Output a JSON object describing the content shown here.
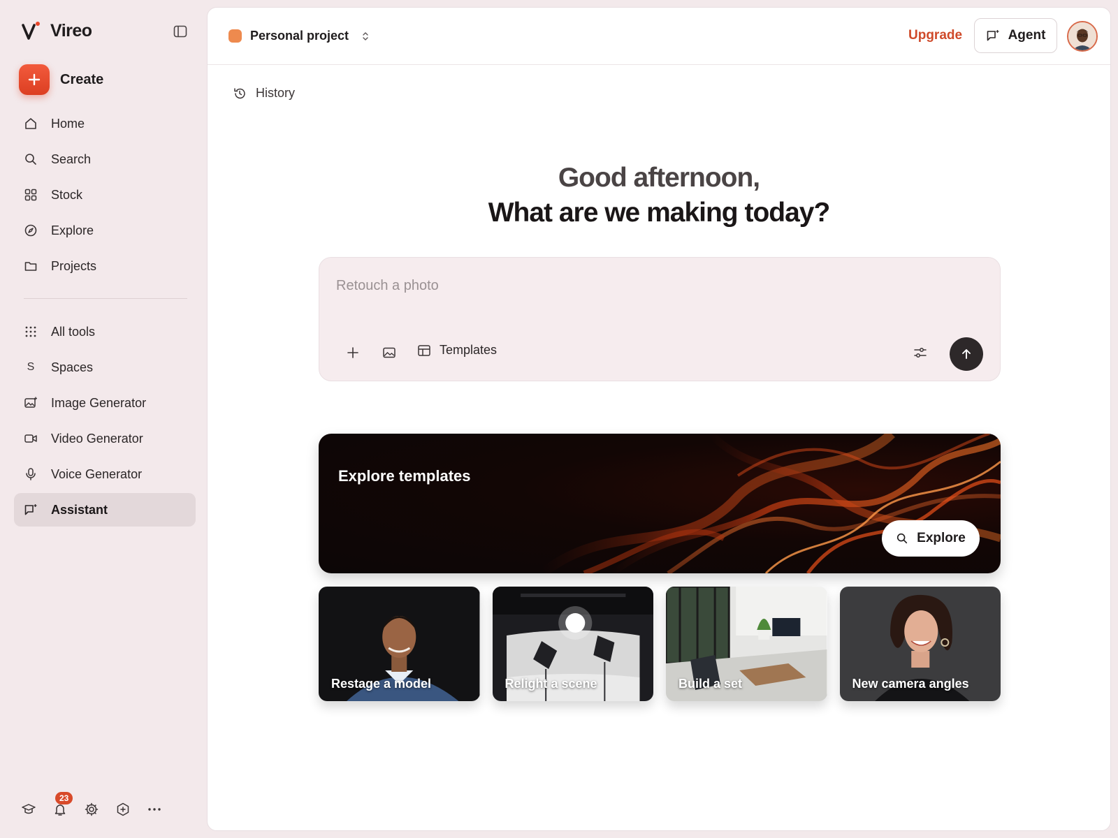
{
  "brand": {
    "name": "Vireo",
    "accent": "#e8472a"
  },
  "sidebar": {
    "create_label": "Create",
    "primary": [
      {
        "label": "Home",
        "icon": "home-icon"
      },
      {
        "label": "Search",
        "icon": "search-icon"
      },
      {
        "label": "Stock",
        "icon": "grid-icon"
      },
      {
        "label": "Explore",
        "icon": "compass-icon"
      },
      {
        "label": "Projects",
        "icon": "folder-icon"
      }
    ],
    "secondary": [
      {
        "label": "All tools",
        "icon": "dots-grid-icon"
      },
      {
        "label": "Spaces",
        "icon": "spaces-s-icon",
        "glyph": "S"
      },
      {
        "label": "Image Generator",
        "icon": "image-sparkle-icon"
      },
      {
        "label": "Video Generator",
        "icon": "video-camera-icon"
      },
      {
        "label": "Voice Generator",
        "icon": "microphone-icon"
      },
      {
        "label": "Assistant",
        "icon": "chat-sparkle-icon",
        "active": true
      }
    ],
    "footer": {
      "notification_count": "23"
    }
  },
  "topbar": {
    "project_name": "Personal project",
    "project_color": "#ee8a4e",
    "upgrade_label": "Upgrade",
    "agent_label": "Agent"
  },
  "main": {
    "history_label": "History",
    "greeting_line1": "Good afternoon,",
    "greeting_line2": "What are we making today?",
    "prompt": {
      "placeholder": "Retouch a photo",
      "templates_label": "Templates"
    },
    "banner": {
      "title": "Explore templates",
      "explore_label": "Explore"
    },
    "cards": [
      {
        "label": "Restage a model"
      },
      {
        "label": "Relight a scene"
      },
      {
        "label": "Build a set"
      },
      {
        "label": "New camera angles"
      }
    ]
  }
}
